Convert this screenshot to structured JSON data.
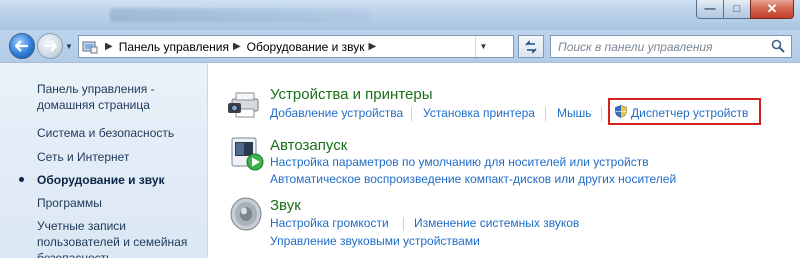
{
  "window": {
    "buttons": {
      "minimize": "—",
      "maximize": "□",
      "close": "✕"
    }
  },
  "nav": {
    "back_icon": "back-arrow-icon",
    "forward_icon": "forward-arrow-icon",
    "breadcrumb": [
      "Панель управления",
      "Оборудование и звук"
    ],
    "search_placeholder": "Поиск в панели управления"
  },
  "sidebar": {
    "items": [
      {
        "label": "Панель управления - домашняя страница",
        "active": false
      },
      {
        "label": "Система и безопасность",
        "active": false
      },
      {
        "label": "Сеть и Интернет",
        "active": false
      },
      {
        "label": "Оборудование и звук",
        "active": true
      },
      {
        "label": "Программы",
        "active": false
      },
      {
        "label": "Учетные записи пользователей и семейная безопасность",
        "active": false
      }
    ]
  },
  "categories": [
    {
      "title": "Устройства и принтеры",
      "icon": "printer-camera-icon",
      "links": [
        "Добавление устройства",
        "Установка принтера",
        "Мышь",
        "Диспетчер устройств"
      ]
    },
    {
      "title": "Автозапуск",
      "icon": "autoplay-icon",
      "links": [
        "Настройка параметров по умолчанию для носителей или устройств",
        "Автоматическое воспроизведение компакт-дисков или других носителей"
      ]
    },
    {
      "title": "Звук",
      "icon": "speaker-icon",
      "links": [
        "Настройка громкости",
        "Изменение системных звуков",
        "Управление звуковыми устройствами"
      ]
    }
  ],
  "colors": {
    "highlight_box": "#d21f1f",
    "link": "#1f6cc8",
    "category_title": "#1a6f1a"
  }
}
